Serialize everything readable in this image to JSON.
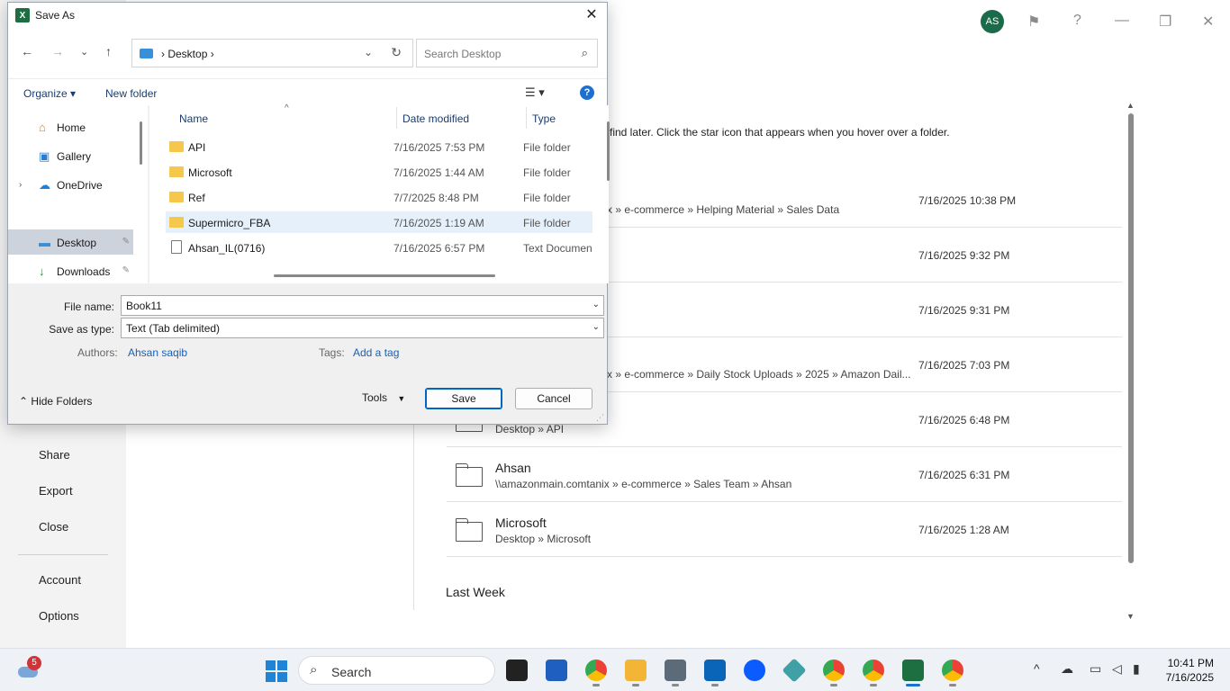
{
  "backstage": {
    "nav": [
      "Share",
      "Export",
      "Close",
      "Account",
      "Options"
    ],
    "avatar_initials": "AS",
    "pin_hint": "find later. Click the star icon that appears when you hover over a folder.",
    "recent": [
      {
        "name": "",
        "path": "x » e-commerce » Helping Material » Sales Data",
        "date": "7/16/2025 10:38 PM"
      },
      {
        "name": "",
        "path": "",
        "date": "7/16/2025 9:32 PM"
      },
      {
        "name": "",
        "path": "",
        "date": "7/16/2025 9:31 PM"
      },
      {
        "name": "",
        "path": "x » e-commerce » Daily Stock Uploads » 2025 » Amazon Dail...",
        "date": "7/16/2025 7:03 PM"
      },
      {
        "name": "",
        "path": "Desktop » API",
        "date": "7/16/2025 6:48 PM"
      },
      {
        "name": "Ahsan",
        "path": "\\\\amazonmain.comtanix » e-commerce » Sales Team » Ahsan",
        "date": "7/16/2025 6:31 PM"
      },
      {
        "name": "Microsoft",
        "path": "Desktop » Microsoft",
        "date": "7/16/2025 1:28 AM"
      }
    ],
    "last_week": "Last Week"
  },
  "dialog": {
    "title": "Save As",
    "app_icon": "excel-icon",
    "address": {
      "crumb": "Desktop",
      "sep": "›"
    },
    "search_placeholder": "Search Desktop",
    "organize": "Organize ▾",
    "new_folder": "New folder",
    "tree": [
      {
        "label": "Home",
        "icon": "home-icon"
      },
      {
        "label": "Gallery",
        "icon": "gallery-icon"
      },
      {
        "label": "OneDrive",
        "icon": "cloud-icon"
      },
      {
        "label": "Desktop",
        "icon": "desktop-icon"
      },
      {
        "label": "Downloads",
        "icon": "download-icon"
      }
    ],
    "columns": {
      "name": "Name",
      "date": "Date modified",
      "type": "Type"
    },
    "files": [
      {
        "name": "API",
        "date": "7/16/2025 7:53 PM",
        "type": "File folder"
      },
      {
        "name": "Microsoft",
        "date": "7/16/2025 1:44 AM",
        "type": "File folder"
      },
      {
        "name": "Ref",
        "date": "7/7/2025 8:48 PM",
        "type": "File folder"
      },
      {
        "name": "Supermicro_FBA",
        "date": "7/16/2025 1:19 AM",
        "type": "File folder"
      },
      {
        "name": "Ahsan_IL(0716)",
        "date": "7/16/2025 6:57 PM",
        "type": "Text Document"
      }
    ],
    "file_name_label": "File name:",
    "file_name_value": "Book11",
    "save_type_label": "Save as type:",
    "save_type_value": "Text (Tab delimited)",
    "authors_label": "Authors:",
    "authors_value": "Ahsan saqib",
    "tags_label": "Tags:",
    "tags_value": "Add a tag",
    "hide_folders": "Hide Folders",
    "tools": "Tools",
    "save": "Save",
    "cancel": "Cancel"
  },
  "taskbar": {
    "weather_badge": "5",
    "search_placeholder": "Search",
    "time": "10:41 PM",
    "date": "7/16/2025"
  }
}
